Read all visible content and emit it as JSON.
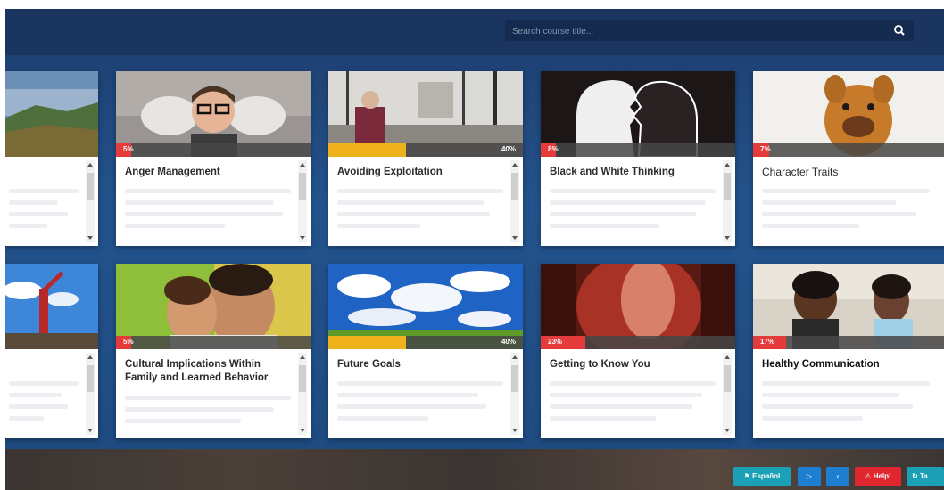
{
  "search": {
    "placeholder": "Search course title...",
    "icon": "search-icon"
  },
  "cards_row1": [
    {
      "title": "",
      "image": "landscape-photo",
      "accent": "#e53b3b"
    },
    {
      "title": "Anger Management",
      "percent": "5%",
      "progress": 0.05,
      "fill_color": "#e53b3b"
    },
    {
      "title": "Avoiding Exploitation",
      "percent": "40%",
      "progress": 0.4,
      "fill_color": "#f0b21c"
    },
    {
      "title": "Black and White Thinking",
      "percent": "8%",
      "progress": 0.08,
      "fill_color": "#e53b3b"
    },
    {
      "title": "Character Traits",
      "percent": "7%",
      "progress": 0.07,
      "fill_color": "#e53b3b"
    }
  ],
  "cards_row2": [
    {
      "title": "",
      "image": "sky-person-photo"
    },
    {
      "title": "Cultural Implications Within Family and Learned Behavior",
      "percent": "5%",
      "progress": 0.05,
      "fill_color": "#e53b3b"
    },
    {
      "title": "Future Goals",
      "percent": "40%",
      "progress": 0.4,
      "fill_color": "#f0b21c"
    },
    {
      "title": "Getting to Know You",
      "percent": "23%",
      "progress": 0.23,
      "fill_color": "#e53b3b"
    },
    {
      "title": "Healthy Communication",
      "percent": "17%",
      "progress": 0.17,
      "fill_color": "#e53b3b"
    }
  ],
  "footer": {
    "espanol": "Español",
    "help": "Help!",
    "last": "Ta",
    "colors": {
      "teal": "#1ca0b6",
      "blue": "#1e7fd0",
      "red": "#e0262e"
    }
  }
}
